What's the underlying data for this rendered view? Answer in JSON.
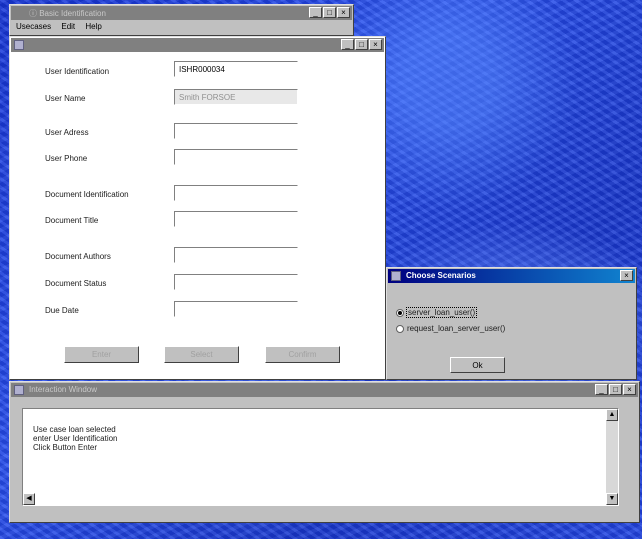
{
  "main_window": {
    "title": "ⓘ Basic Identification",
    "menu": [
      "Usecases",
      "Edit",
      "Help"
    ]
  },
  "form": {
    "fields": [
      {
        "label": "User Identification",
        "value": "ISHR000034",
        "placeholder": ""
      },
      {
        "label": "User Name",
        "value": "Smith FORSOE",
        "placeholder": ""
      },
      {
        "label": "User Adress",
        "value": "",
        "placeholder": ""
      },
      {
        "label": "User Phone",
        "value": "",
        "placeholder": ""
      },
      {
        "label": "Document Identification",
        "value": "",
        "placeholder": ""
      },
      {
        "label": "Document Title",
        "value": "",
        "placeholder": ""
      },
      {
        "label": "Document Authors",
        "value": "",
        "placeholder": ""
      },
      {
        "label": "Document Status",
        "value": "",
        "placeholder": ""
      },
      {
        "label": "Due Date",
        "value": "",
        "placeholder": ""
      }
    ],
    "buttons": [
      "Enter",
      "Select",
      "Confirm"
    ]
  },
  "scenarios": {
    "title": "Choose Scenarios",
    "options": [
      {
        "label": "server_loan_user()",
        "checked": true
      },
      {
        "label": "request_loan_server_user()",
        "checked": false
      }
    ],
    "ok_label": "Ok"
  },
  "log_window": {
    "title": "Interaction Window",
    "lines": [
      "Use case loan selected",
      "enter User Identification",
      "Click Button Enter"
    ]
  },
  "colors": {
    "desktop": "#2244e0",
    "window": "#c0c0c0",
    "active_title": "#000080",
    "inactive_title": "#808080"
  }
}
